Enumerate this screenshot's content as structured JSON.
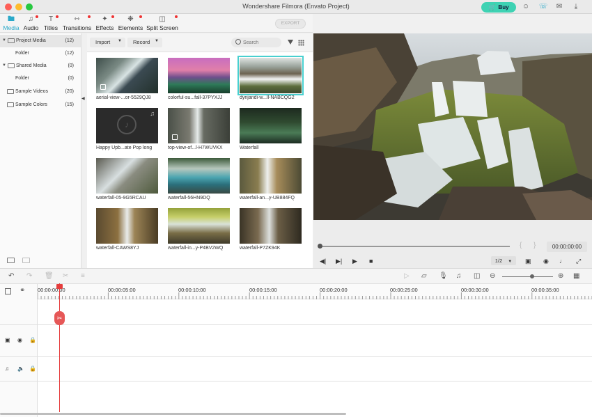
{
  "window": {
    "title": "Wondershare Filmora (Envato Project)"
  },
  "topbar": {
    "buy_label": "Buy"
  },
  "tabs": [
    {
      "label": "Media",
      "icon": "folder-icon",
      "active": true
    },
    {
      "label": "Audio",
      "icon": "music-note-icon"
    },
    {
      "label": "Titles",
      "icon": "text-title-icon"
    },
    {
      "label": "Transitions",
      "icon": "transition-icon"
    },
    {
      "label": "Effects",
      "icon": "effects-wand-icon"
    },
    {
      "label": "Elements",
      "icon": "elements-icon"
    },
    {
      "label": "Split Screen",
      "icon": "split-screen-icon"
    }
  ],
  "export_label": "EXPORT",
  "library": {
    "items": [
      {
        "label": "Project Media",
        "count": "(12)"
      },
      {
        "label": "Folder",
        "count": "(12)"
      },
      {
        "label": "Shared Media",
        "count": "(0)"
      },
      {
        "label": "Folder",
        "count": "(0)"
      },
      {
        "label": "Sample Videos",
        "count": "(20)"
      },
      {
        "label": "Sample Colors",
        "count": "(15)"
      }
    ]
  },
  "media_toolbar": {
    "import_label": "Import",
    "record_label": "Record",
    "search_placeholder": "Search"
  },
  "media": [
    {
      "caption": "aerial-view-...or-5529QJ8"
    },
    {
      "caption": "colorful-su...fall-37PYXJJ"
    },
    {
      "caption": "dynjandi-w...ll-NABCQG2"
    },
    {
      "caption": "Happy Upb...ate Pop long"
    },
    {
      "caption": "top-view-of...l-H7WUVKX"
    },
    {
      "caption": "Waterfall"
    },
    {
      "caption": "waterfall-05-9G5RCAU"
    },
    {
      "caption": "waterfall-56HN9DQ"
    },
    {
      "caption": "waterfall-an...y-UB884FQ"
    },
    {
      "caption": "waterfall-CAWS8YJ"
    },
    {
      "caption": "waterfall-in...y-P4BV2WQ"
    },
    {
      "caption": "waterfall-P7ZK94K"
    }
  ],
  "player": {
    "timecode": "00:00:00:00",
    "ratio": "1/2"
  },
  "ruler": {
    "labels": [
      "00:00:00:00",
      "00:00:05:00",
      "00:00:10:00",
      "00:00:15:00",
      "00:00:20:00",
      "00:00:25:00",
      "00:00:30:00",
      "00:00:35:00"
    ]
  },
  "colors": {
    "accent": "#2aa9c9",
    "buy": "#3ed2b3",
    "playhead": "#e53c3c",
    "selection": "#48d0d0"
  }
}
